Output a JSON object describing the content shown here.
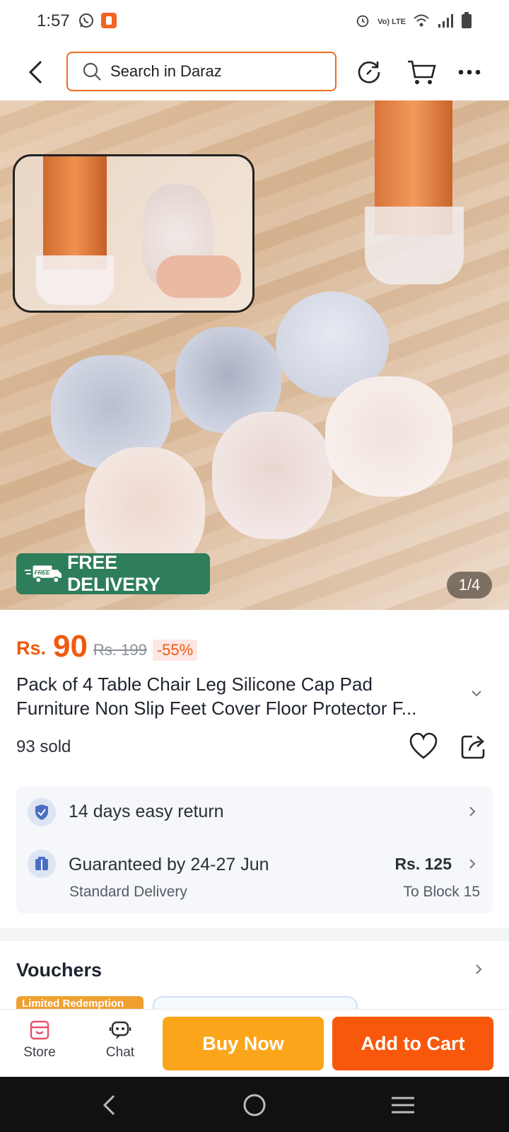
{
  "status_bar": {
    "time": "1:57",
    "left_icons": [
      "whatsapp-icon",
      "app-notification-icon"
    ],
    "right_icons": [
      "alarm-icon",
      "volte-icon",
      "wifi-icon",
      "signal-icon",
      "battery-icon"
    ],
    "volte_label": "Vo) LTE"
  },
  "header": {
    "search_placeholder": "Search in Daraz",
    "icons": [
      "back-icon",
      "search-icon",
      "history-icon",
      "cart-icon",
      "more-icon"
    ]
  },
  "gallery": {
    "badge_label": "FREE DELIVERY",
    "badge_truck_text": "FREE",
    "page_indicator": "1/4"
  },
  "product": {
    "currency": "Rs.",
    "price": "90",
    "original_price": "Rs. 199",
    "discount": "-55%",
    "title_line1": "Pack of 4 Table Chair Leg Silicone Cap Pad",
    "title_line2": "Furniture Non Slip Feet Cover Floor Protector F...",
    "sold": "93 sold"
  },
  "services": {
    "return_label": "14 days easy return",
    "delivery_label": "Guaranteed by 24-27 Jun",
    "delivery_type": "Standard Delivery",
    "delivery_fee": "Rs. 125",
    "delivery_to": "To Block 15"
  },
  "vouchers": {
    "title": "Vouchers",
    "limited_label": "Limited Redemption"
  },
  "bottom_bar": {
    "store_label": "Store",
    "chat_label": "Chat",
    "buy_now_label": "Buy Now",
    "add_to_cart_label": "Add to Cart"
  },
  "colors": {
    "brand_orange": "#f8580c",
    "buy_now_yellow": "#fba61a",
    "free_delivery_green": "#2e7d5b",
    "discount_bg": "#fde7e4"
  }
}
